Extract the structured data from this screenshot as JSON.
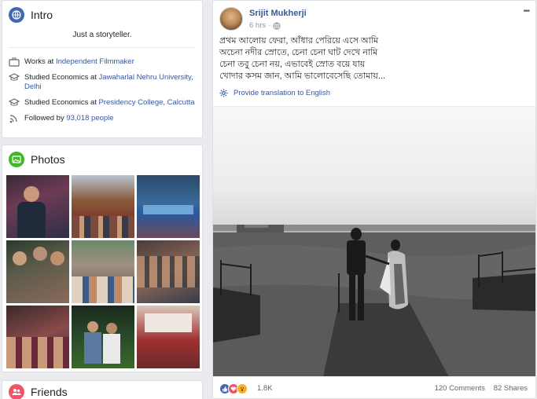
{
  "intro": {
    "title": "Intro",
    "tagline": "Just a storyteller.",
    "work": {
      "prefix": "Works at ",
      "place": "Independent Filmmaker"
    },
    "study1": {
      "prefix": "Studied Economics at ",
      "place": "Jawaharlal Nehru University, Delhi"
    },
    "study2": {
      "prefix": "Studied Economics at ",
      "place": "Presidency College, Calcutta"
    },
    "followers": {
      "prefix": "Followed by ",
      "count": "93,018 people"
    }
  },
  "photos": {
    "title": "Photos"
  },
  "friends": {
    "title": "Friends"
  },
  "post": {
    "author": "Srijit Mukherji",
    "time": "6 hrs",
    "more_label": "•••",
    "lines": [
      "প্রথম আলোয় ফেরা, আঁধার পেরিয়ে এসে আমি",
      "অচেনা নদীর স্রোতে, চেনা চেনা ঘাট দেখে নামি",
      "চেনা তবু চেনা নয়, এভাবেই স্রোত বয়ে যায়",
      "খোদার কসম জান, আমি ভালোবেসেছি তোমায়..."
    ],
    "translate_label": "Provide translation to English",
    "reactions_count": "1.8K",
    "comments": "120 Comments",
    "shares": "82 Shares"
  },
  "colors": {
    "accent": "#385898",
    "intro_icon": "#4267b2",
    "photos_icon": "#42b72a",
    "friends_icon": "#f35369"
  },
  "icons": {
    "intro": "globe-icon",
    "work": "briefcase-icon",
    "study": "graduation-cap-icon",
    "followers": "rss-icon",
    "privacy": "globe-small-icon",
    "translate": "gear-icon"
  }
}
